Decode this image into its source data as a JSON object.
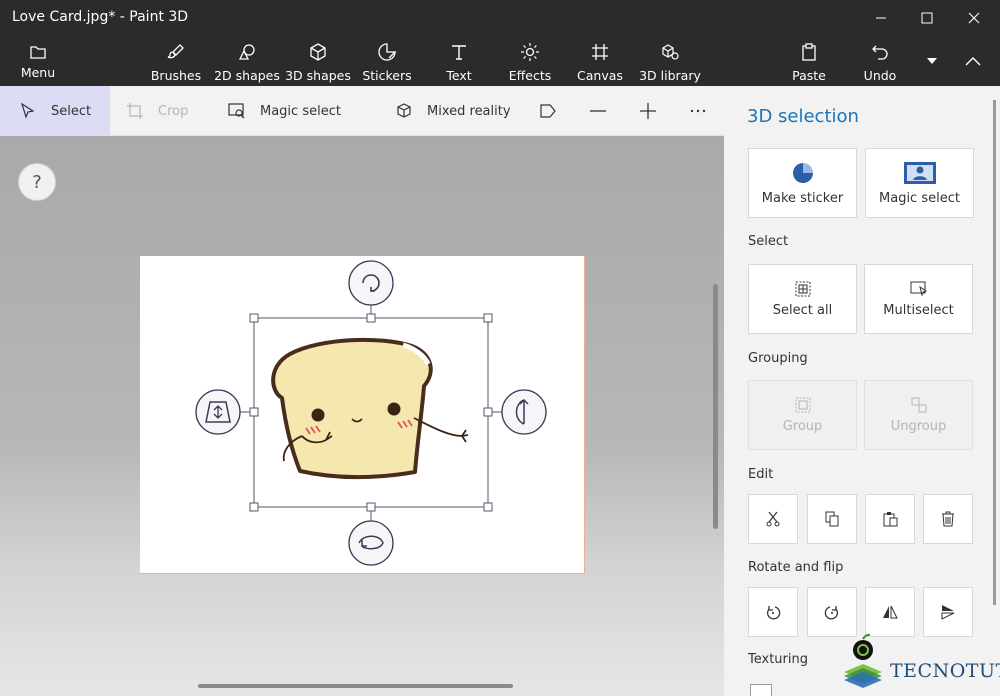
{
  "window": {
    "title": "Love Card.jpg* - Paint 3D",
    "controls": [
      "minimize-icon",
      "maximize-icon",
      "close-icon"
    ]
  },
  "ribbon": {
    "menu": {
      "label": "Menu",
      "icon": "folder-icon"
    },
    "tools": [
      {
        "label": "Brushes",
        "icon": "brush-icon"
      },
      {
        "label": "2D shapes",
        "icon": "2d-shapes-icon"
      },
      {
        "label": "3D shapes",
        "icon": "cube-icon"
      },
      {
        "label": "Stickers",
        "icon": "sticker-icon"
      },
      {
        "label": "Text",
        "icon": "text-icon"
      },
      {
        "label": "Effects",
        "icon": "sun-icon"
      },
      {
        "label": "Canvas",
        "icon": "canvas-icon"
      },
      {
        "label": "3D library",
        "icon": "3d-library-icon"
      }
    ],
    "paste": {
      "label": "Paste",
      "icon": "paste-icon"
    },
    "undo": {
      "label": "Undo",
      "icon": "undo-icon"
    }
  },
  "toolbar": {
    "select": "Select",
    "crop": "Crop",
    "magic_select": "Magic select",
    "mixed_reality": "Mixed reality"
  },
  "canvas": {
    "help": "?",
    "selected_object": "toast-sticker"
  },
  "panel": {
    "title": "3D selection",
    "make_sticker": "Make sticker",
    "magic_select": "Magic select",
    "select_section": "Select",
    "select_all": "Select all",
    "multiselect": "Multiselect",
    "grouping_section": "Grouping",
    "group": "Group",
    "ungroup": "Ungroup",
    "edit_section": "Edit",
    "edit_buttons": [
      "cut-icon",
      "copy-icon",
      "paste-icon",
      "delete-icon"
    ],
    "rotate_section": "Rotate and flip",
    "rotate_buttons": [
      "rotate-left-icon",
      "rotate-right-icon",
      "flip-horizontal-icon",
      "flip-vertical-icon"
    ],
    "texturing_section": "Texturing"
  },
  "watermark": {
    "text": "TECNOTUTO"
  },
  "colors": {
    "titlebar": "#2b2b2b",
    "accent": "#1a73b8",
    "active_tool": "#dcdcf5",
    "panel": "#f2f2f2"
  }
}
